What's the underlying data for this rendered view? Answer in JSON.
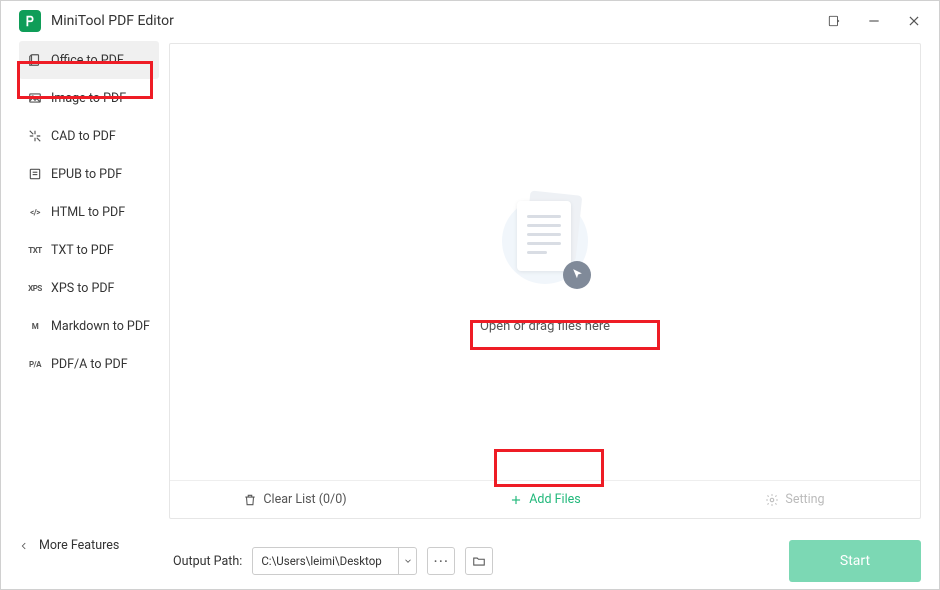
{
  "app": {
    "title": "MiniTool PDF Editor"
  },
  "sidebar": {
    "items": [
      {
        "label": "Office to PDF",
        "icon": "O"
      },
      {
        "label": "Image to PDF",
        "icon": "img"
      },
      {
        "label": "CAD to PDF",
        "icon": "cad"
      },
      {
        "label": "EPUB to PDF",
        "icon": "epub"
      },
      {
        "label": "HTML to PDF",
        "icon": "</>"
      },
      {
        "label": "TXT to PDF",
        "icon": "TXT"
      },
      {
        "label": "XPS to PDF",
        "icon": "XPS"
      },
      {
        "label": "Markdown to PDF",
        "icon": "M"
      },
      {
        "label": "PDF/A to PDF",
        "icon": "P/A"
      }
    ]
  },
  "more_features": "More Features",
  "canvas": {
    "hint": "Open or drag files here"
  },
  "actions": {
    "clear": "Clear List (0/0)",
    "add": "Add Files",
    "setting": "Setting"
  },
  "footer": {
    "output_label": "Output Path:",
    "output_path": "C:\\Users\\leimi\\Desktop",
    "ellipsis": "···",
    "start": "Start"
  }
}
